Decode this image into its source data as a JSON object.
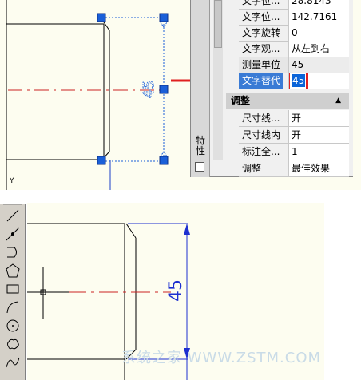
{
  "top": {
    "ucs_label": "Y",
    "props": {
      "sidebar_title": "特性",
      "rows": [
        {
          "key": "文字位...",
          "value": "28.8143"
        },
        {
          "key": "文字位...",
          "value": "142.7161"
        },
        {
          "key": "文字旋转",
          "value": "0"
        },
        {
          "key": "文字观...",
          "value": "从左到右"
        },
        {
          "key": "测量单位",
          "value": "45"
        },
        {
          "key": "文字替代",
          "value": "45"
        }
      ],
      "section": {
        "label": "调整",
        "collapse_arrow": "▲"
      },
      "adjust_rows": [
        {
          "key": "尺寸线...",
          "value": "开"
        },
        {
          "key": "尺寸线内",
          "value": "开"
        },
        {
          "key": "标注全...",
          "value": "1"
        },
        {
          "key": "调整",
          "value": "最佳效果"
        }
      ]
    }
  },
  "bottom": {
    "dimension_text": "45",
    "watermark": "系统之家 WWW.ZSTM.COM"
  },
  "colors": {
    "background": "#fdfdf0",
    "selection_blue": "#1a5fd8",
    "highlight_red": "#e02020",
    "dimension_blue": "#1d2fd0",
    "centerline_red": "#cc2222"
  }
}
